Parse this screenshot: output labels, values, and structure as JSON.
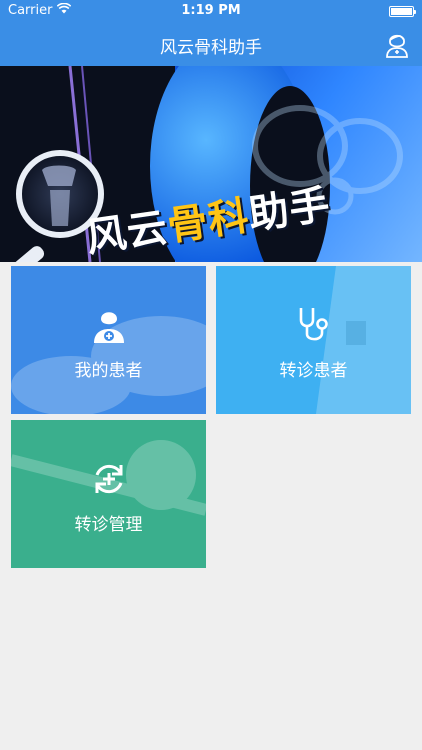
{
  "status_bar": {
    "carrier": "Carrier",
    "time": "1:19 PM",
    "battery_level": 1.0
  },
  "nav": {
    "title": "风云骨科助手",
    "profile_icon": "doctor-profile-icon"
  },
  "banner": {
    "headline_part1": "风云",
    "headline_part2": "骨科",
    "headline_part3": "助手",
    "page_indicator_count": 1
  },
  "tiles": [
    {
      "label": "我的患者",
      "icon": "doctor-plus-icon",
      "color": "#3d8ae6"
    },
    {
      "label": "转诊患者",
      "icon": "stethoscope-icon",
      "color": "#3eb0f2"
    },
    {
      "label": "转诊管理",
      "icon": "refresh-plus-icon",
      "color": "#3aaf8d"
    }
  ],
  "colors": {
    "primary": "#3a8ee6",
    "background": "#efefef",
    "headline_accent": "#ffc515"
  }
}
